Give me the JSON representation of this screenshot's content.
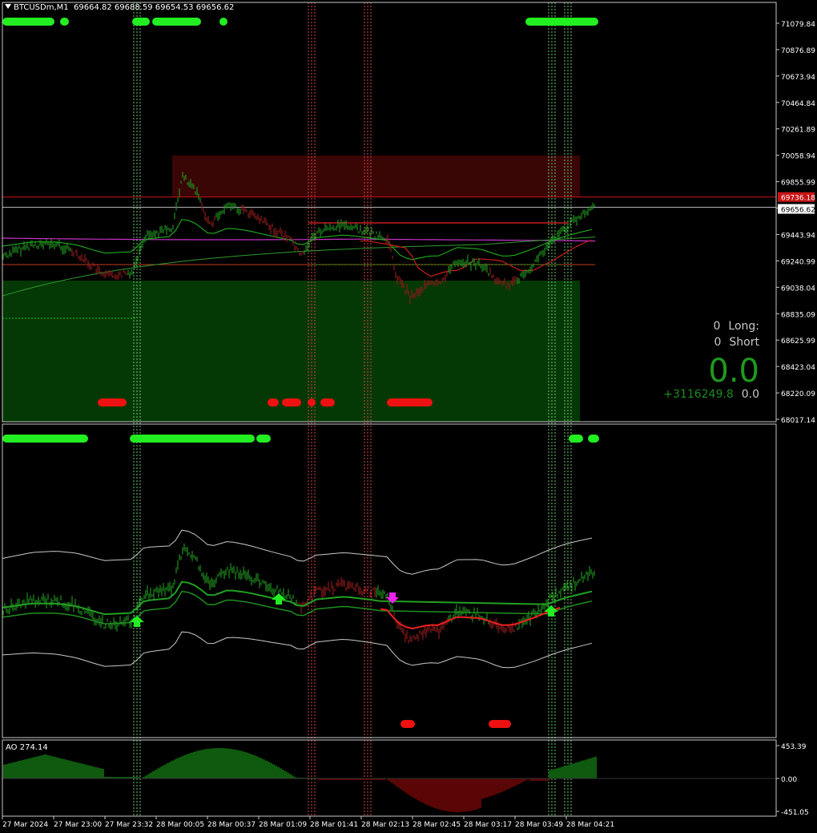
{
  "window": {
    "symbol_tf": "BTCUSDm,M1",
    "ohlc": "69664.82 69688.59 69654.53 69656.62"
  },
  "price_axis": {
    "labels": [
      "71079.84",
      "70876.89",
      "70673.94",
      "70464.84",
      "70261.89",
      "70058.94",
      "69855.99",
      "69656.62",
      "69443.94",
      "69240.99",
      "69038.04",
      "68835.09",
      "68625.99",
      "68423.04",
      "68220.09",
      "68017.14"
    ],
    "red_line_label": "69736.18",
    "current_price_label": "69656.62",
    "range": [
      68017.14,
      71079.84
    ]
  },
  "ao_panel": {
    "label": "AO 274.14",
    "axis_labels": [
      "453.39",
      "0.00",
      "-451.05"
    ],
    "range": [
      -451.05,
      453.39
    ]
  },
  "time_axis": {
    "labels": [
      "27 Mar 2024",
      "27 Mar 23:00",
      "27 Mar 23:32",
      "28 Mar 00:05",
      "28 Mar 00:37",
      "28 Mar 01:09",
      "28 Mar 01:41",
      "28 Mar 02:13",
      "28 Mar 02:45",
      "28 Mar 03:17",
      "28 Mar 03:49",
      "28 Mar 04:21"
    ]
  },
  "stats": {
    "long_count": "0",
    "long_label": "Long:",
    "short_count": "0",
    "short_label": "Short",
    "big_value": "0.0",
    "profit_value": "+3116249.8",
    "profit_right": "0.0"
  },
  "colors": {
    "background": "#000000",
    "bull": "#1f8f1f",
    "bear": "#8b1a1a",
    "signal_green": "#22ee22",
    "signal_red": "#ee1111",
    "supply_zone": "#3a0505",
    "demand_zone": "#043804",
    "magenta": "#ee22ee"
  },
  "icons": [
    "buy-arrow-icon",
    "sell-arrow-icon",
    "dropdown-triangle-icon"
  ]
}
